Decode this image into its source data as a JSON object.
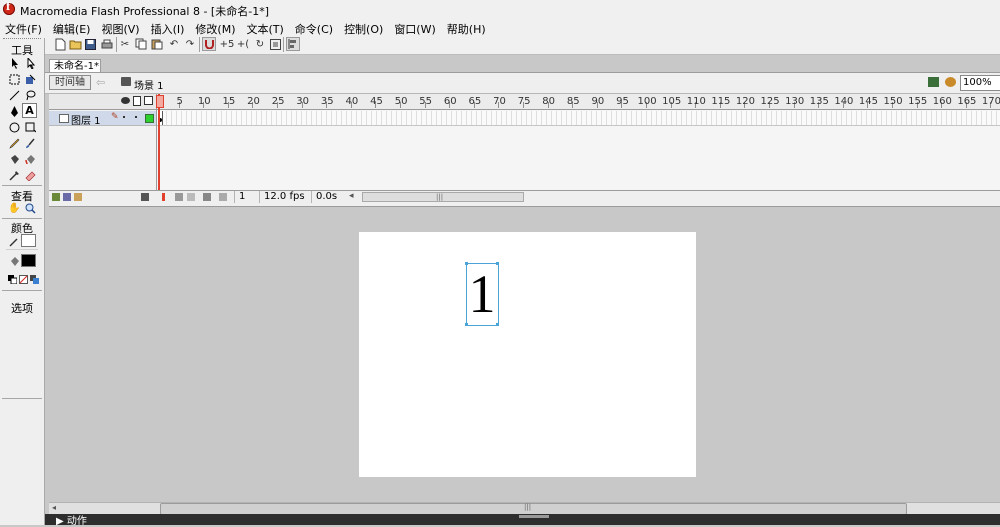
{
  "window": {
    "title": "Macromedia Flash Professional 8 - [未命名-1*]"
  },
  "menu": [
    "文件(F)",
    "编辑(E)",
    "视图(V)",
    "插入(I)",
    "修改(M)",
    "文本(T)",
    "命令(C)",
    "控制(O)",
    "窗口(W)",
    "帮助(H)"
  ],
  "toolbar": {
    "icons": [
      "new-file-icon",
      "open-folder-icon",
      "save-icon",
      "print-icon",
      "cut-icon",
      "copy-icon",
      "paste-icon",
      "undo-icon",
      "redo-icon",
      "snap-magnet-icon",
      "smooth-icon",
      "straighten-icon",
      "rotate-icon",
      "scale-icon",
      "align-icon"
    ]
  },
  "tools": {
    "header": "工具",
    "view_header": "查看",
    "colors_header": "颜色",
    "options_header": "选项"
  },
  "document": {
    "tab": "未命名-1*",
    "timeline_button": "时间轴",
    "scene": "场景 1",
    "zoom": "100%"
  },
  "timeline": {
    "ruler_labels": [
      "5",
      "10",
      "15",
      "20",
      "25",
      "30",
      "35",
      "40",
      "45",
      "50",
      "55",
      "60",
      "65",
      "70",
      "75",
      "80",
      "85",
      "90",
      "95",
      "100",
      "105",
      "110",
      "115",
      "120",
      "125",
      "130",
      "135",
      "140",
      "145",
      "150",
      "155",
      "160",
      "165",
      "170"
    ],
    "layer": {
      "name": "图层 1"
    },
    "status": {
      "current_frame": "1",
      "fps": "12.0 fps",
      "elapsed": "0.0s"
    }
  },
  "stage": {
    "text": "1"
  },
  "panels": {
    "properties": "▶ 动作"
  },
  "colors": {
    "accent": "#e0402e",
    "selection": "#4aa4d8",
    "stage": "#ffffff",
    "workspace": "#c8c8c8"
  }
}
